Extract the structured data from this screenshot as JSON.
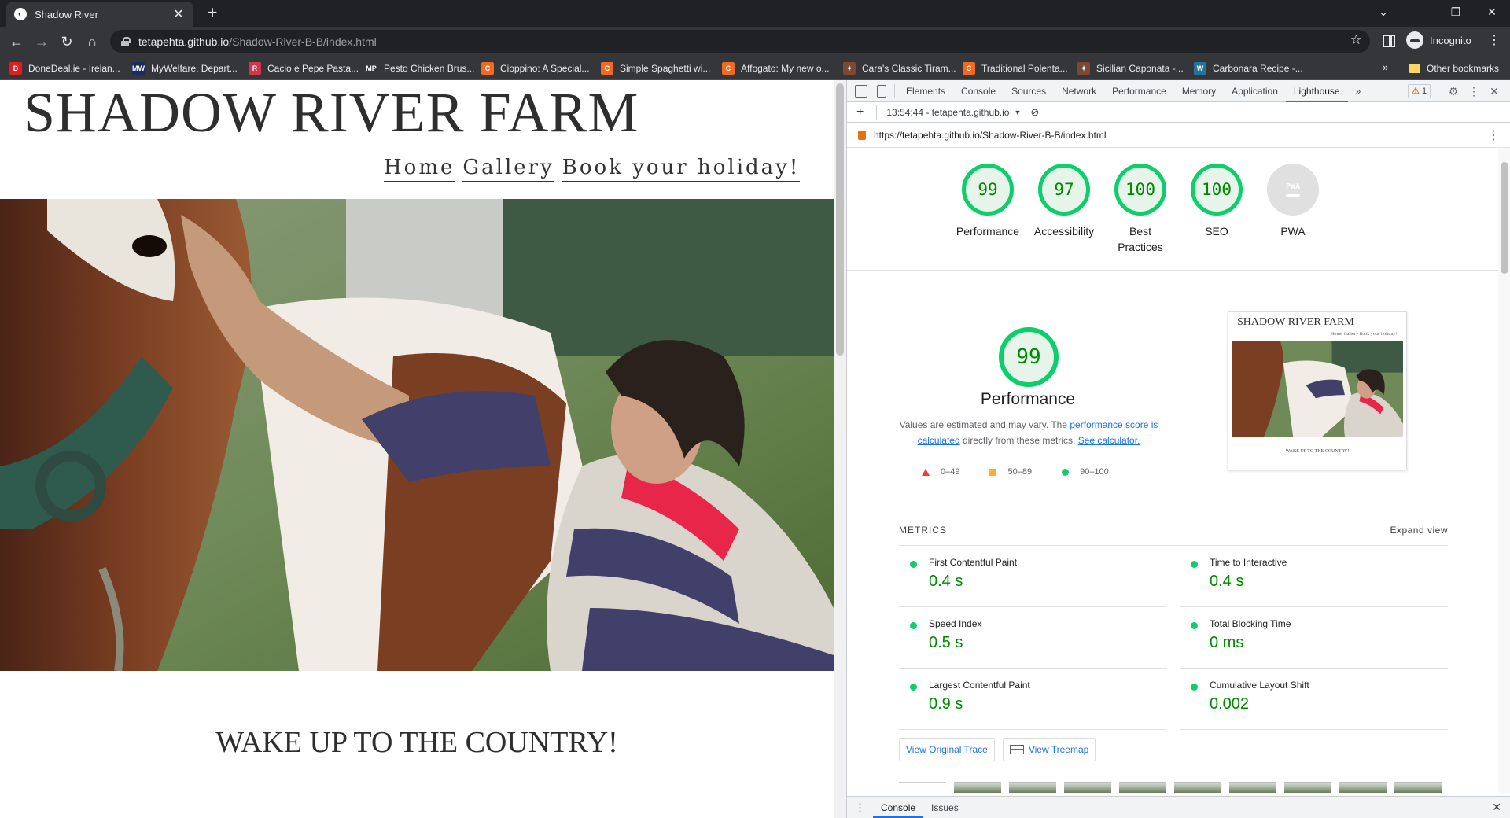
{
  "browser": {
    "tab_title": "Shadow River",
    "tab_favicon_glyph": "◐",
    "tab_close": "✕",
    "newtab_glyph": "+",
    "url_host": "tetapehta.github.io",
    "url_path": "/Shadow-River-B-B/index.html",
    "incognito_label": "Incognito",
    "window_controls": [
      "⌄",
      "—",
      "❐",
      "✕"
    ],
    "nav": {
      "back": "←",
      "forward": "→",
      "reload": "↻",
      "home": "⌂",
      "star": "☆",
      "menu": "⋮"
    }
  },
  "bookmarks": [
    {
      "label": "DoneDeal.ie - Irelan...",
      "icon_text": "D",
      "color": "#e01e1e"
    },
    {
      "label": "MyWelfare, Depart...",
      "icon_text": "MW",
      "color": "#1d2b63"
    },
    {
      "label": "Cacio e Pepe Pasta...",
      "icon_text": "R",
      "color": "#d2364b"
    },
    {
      "label": "Pesto Chicken Brus...",
      "icon_text": "MP",
      "color": "#35363a"
    },
    {
      "label": "Cioppino: A Special...",
      "icon_text": "C",
      "color": "#f26a21"
    },
    {
      "label": "Simple Spaghetti wi...",
      "icon_text": "C",
      "color": "#f26a21"
    },
    {
      "label": "Affogato: My new o...",
      "icon_text": "C",
      "color": "#f26a21"
    },
    {
      "label": "Cara's Classic Tiram...",
      "icon_text": "✦",
      "color": "#7a4a35"
    },
    {
      "label": "Traditional Polenta...",
      "icon_text": "C",
      "color": "#f26a21"
    },
    {
      "label": "Sicilian Caponata -...",
      "icon_text": "✦",
      "color": "#7a4a35"
    },
    {
      "label": "Carbonara Recipe -...",
      "icon_text": "W",
      "color": "#21759b"
    }
  ],
  "bookmarks_more": "»",
  "other_bookmarks": "Other bookmarks",
  "site": {
    "title": "SHADOW RIVER FARM",
    "nav": [
      "Home",
      "Gallery",
      "Book your holiday!"
    ],
    "tagline": "WAKE UP TO THE COUNTRY!"
  },
  "devtools": {
    "tabs": [
      "Elements",
      "Console",
      "Sources",
      "Network",
      "Performance",
      "Memory",
      "Application",
      "Lighthouse"
    ],
    "more_tabs": "»",
    "warning_count": "1",
    "warning_glyph": "⚠",
    "run_time": "13:54:44 - tetapehta.github.io",
    "report_url": "https://tetapehta.github.io/Shadow-River-B-B/index.html",
    "drawer_tabs": [
      "Console",
      "Issues"
    ]
  },
  "lighthouse": {
    "scores": [
      {
        "label": "Performance",
        "value": "99"
      },
      {
        "label": "Accessibility",
        "value": "97"
      },
      {
        "label": "Best Practices",
        "value": "100"
      },
      {
        "label": "SEO",
        "value": "100"
      },
      {
        "label": "PWA",
        "value": "PWA"
      }
    ],
    "perf_score": "99",
    "perf_title": "Performance",
    "note_prefix": "Values are estimated and may vary. The ",
    "note_link1": "performance score is calculated",
    "note_mid": " directly from these metrics. ",
    "note_link2": "See calculator.",
    "legend": [
      "0–49",
      "50–89",
      "90–100"
    ],
    "screenshot_title": "SHADOW RIVER FARM",
    "screenshot_nav": "Home Gallery Book your holiday!",
    "screenshot_tagline": "WAKE UP TO THE COUNTRY!",
    "metrics_header": "METRICS",
    "expand_view": "Expand view",
    "metrics": [
      {
        "name": "First Contentful Paint",
        "value": "0.4 s"
      },
      {
        "name": "Time to Interactive",
        "value": "0.4 s"
      },
      {
        "name": "Speed Index",
        "value": "0.5 s"
      },
      {
        "name": "Total Blocking Time",
        "value": "0 ms"
      },
      {
        "name": "Largest Contentful Paint",
        "value": "0.9 s"
      },
      {
        "name": "Cumulative Layout Shift",
        "value": "0.002"
      }
    ],
    "view_trace": "View Original Trace",
    "view_treemap": "View Treemap"
  },
  "colors": {
    "pass": "#0cce6b",
    "pass_text": "#008800",
    "link": "#1a73e8"
  }
}
